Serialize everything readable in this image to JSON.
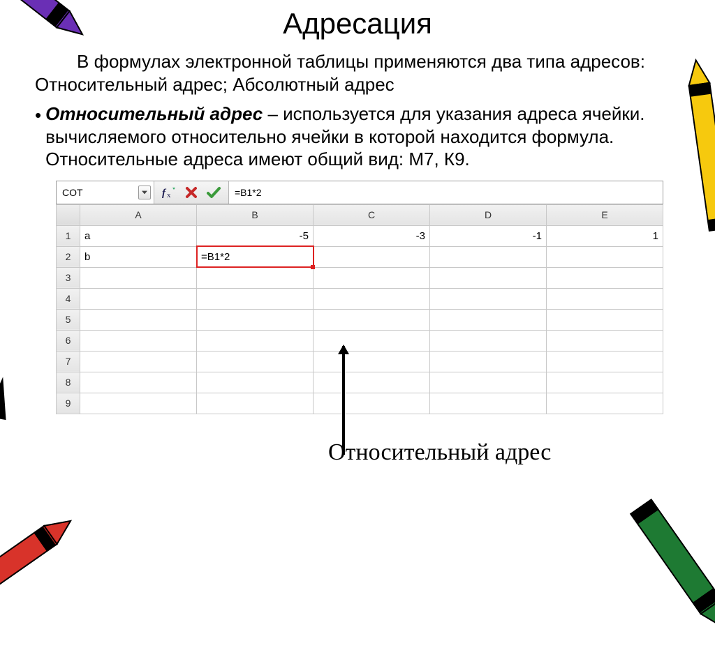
{
  "title": "Адресация",
  "intro": "В формулах электронной таблицы применяются два типа адресов:  Относительный адрес; Абсолютный адрес",
  "bullet": {
    "term": "Относительный адрес",
    "rest": " – используется для указания адреса ячейки. вычисляемого относительно ячейки в которой находится формула. Относительные адреса имеют общий вид: М7, К9."
  },
  "sheet": {
    "name_box": "COT",
    "formula": "=B1*2",
    "columns": [
      "A",
      "B",
      "C",
      "D",
      "E"
    ],
    "rows": [
      "1",
      "2",
      "3",
      "4",
      "5",
      "6",
      "7",
      "8",
      "9"
    ],
    "cells": {
      "A1": "a",
      "B1": "-5",
      "C1": "-3",
      "D1": "-1",
      "E1": "1",
      "A2": "b",
      "B2": "=B1*2"
    },
    "active_col": "B",
    "active_row": "2"
  },
  "callout": "Относительный адрес",
  "icons": {
    "fx": "fx-icon",
    "cancel": "cancel-icon",
    "accept": "accept-icon",
    "dropdown": "chevron-down-icon"
  }
}
